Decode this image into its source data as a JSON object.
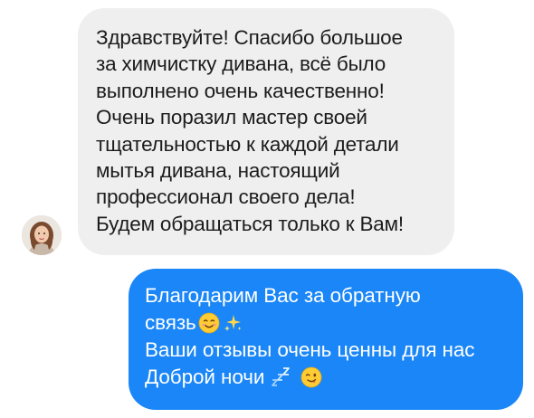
{
  "conversation": {
    "incoming": {
      "lines": [
        "Здравствуйте! Спасибо большое",
        "за химчистку дивана, всё было",
        "выполнено очень качественно!",
        "Очень поразил мастер своей",
        "тщательностью к каждой детали",
        "мытья дивана, настоящий",
        "профессионал своего дела!",
        "Будем обращаться только к Вам!"
      ],
      "bubble_color": "#efefef",
      "text_color": "#1c1c1c"
    },
    "outgoing": {
      "lines": [
        "Благодарим Вас за обратную",
        "связь",
        "Ваши отзывы очень ценны для нас",
        "Доброй ночи"
      ],
      "emojis": {
        "line2": [
          "smiling-face-emoji",
          "sparkles-emoji"
        ],
        "line4": [
          "zzz-emoji",
          "winking-face-emoji"
        ]
      },
      "bubble_color": "#1a86f7",
      "text_color": "#ffffff"
    },
    "avatar_icon": "user-avatar"
  }
}
